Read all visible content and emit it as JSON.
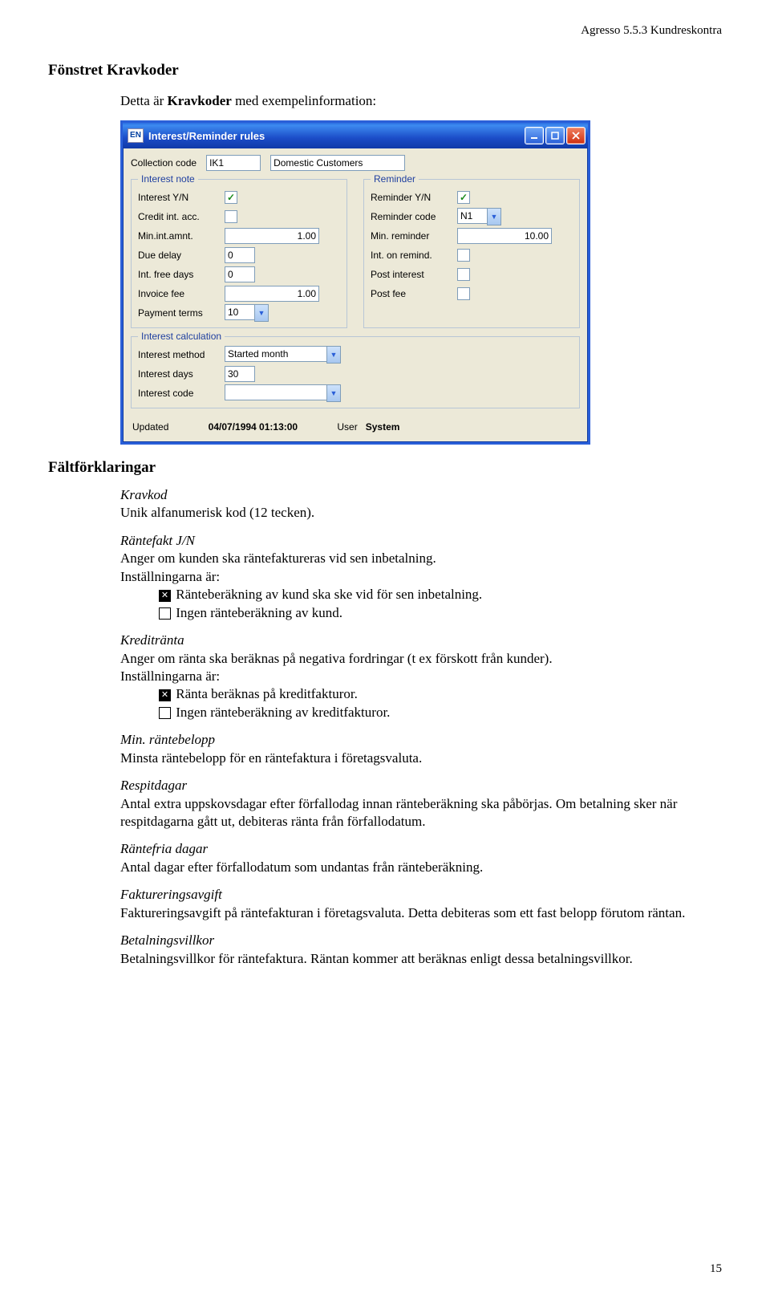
{
  "header": {
    "running": "Agresso 5.5.3 Kundreskontra"
  },
  "section_title": "Fönstret Kravkoder",
  "intro_prefix": "Detta är ",
  "intro_bold": "Kravkoder",
  "intro_suffix": " med exempelinformation:",
  "dialog": {
    "badge": "EN",
    "title": "Interest/Reminder rules",
    "collection_code_label": "Collection code",
    "collection_code": "IK1",
    "collection_name": "Domestic Customers",
    "group_interest": "Interest note",
    "group_reminder": "Reminder",
    "interest_yn_label": "Interest Y/N",
    "credit_int_acc_label": "Credit int. acc.",
    "min_int_amnt_label": "Min.int.amnt.",
    "min_int_amnt": "1.00",
    "due_delay_label": "Due delay",
    "due_delay": "0",
    "int_free_days_label": "Int. free days",
    "int_free_days": "0",
    "invoice_fee_label": "Invoice fee",
    "invoice_fee": "1.00",
    "payment_terms_label": "Payment terms",
    "payment_terms": "10",
    "reminder_yn_label": "Reminder Y/N",
    "reminder_code_label": "Reminder code",
    "reminder_code": "N1",
    "min_reminder_label": "Min. reminder",
    "min_reminder": "10.00",
    "int_on_remind_label": "Int. on remind.",
    "post_interest_label": "Post interest",
    "post_fee_label": "Post fee",
    "group_calc": "Interest calculation",
    "interest_method_label": "Interest method",
    "interest_method": "Started month",
    "interest_days_label": "Interest days",
    "interest_days": "30",
    "interest_code_label": "Interest code",
    "updated_label": "Updated",
    "updated": "04/07/1994 01:13:00",
    "user_label": "User",
    "user": "System"
  },
  "explain_title": "Fältförklaringar",
  "e": {
    "kravkod_t": "Kravkod",
    "kravkod_d": "Unik alfanumerisk kod (12 tecken).",
    "rantjn_t": "Räntefakt J/N",
    "rantjn_d": "Anger om kunden ska räntefaktureras vid sen inbetalning.",
    "inst": "Inställningarna är:",
    "rantjn_opt1": "Ränteberäkning av kund ska ske vid för sen inbetalning.",
    "rantjn_opt2": "Ingen ränteberäkning av kund.",
    "kredit_t": "Kreditränta",
    "kredit_d": "Anger om ränta ska beräknas på negativa fordringar (t ex förskott från kunder).",
    "kredit_opt1": "Ränta beräknas på kreditfakturor.",
    "kredit_opt2": "Ingen ränteberäkning av kreditfakturor.",
    "minr_t": "Min. räntebelopp",
    "minr_d": "Minsta räntebelopp för en räntefaktura i företagsvaluta.",
    "respit_t": "Respitdagar",
    "respit_d": "Antal extra uppskovsdagar efter förfallodag innan ränteberäkning ska påbörjas. Om betalning sker när respitdagarna gått ut, debiteras ränta från förfallodatum.",
    "rfri_t": "Räntefria dagar",
    "rfri_d": "Antal dagar efter förfallodatum som undantas från ränteberäkning.",
    "favg_t": "Faktureringsavgift",
    "favg_d": "Faktureringsavgift på räntefakturan i företagsvaluta. Detta debiteras som ett fast belopp förutom räntan.",
    "bvill_t": "Betalningsvillkor",
    "bvill_d": "Betalningsvillkor för räntefaktura. Räntan kommer att beräknas enligt dessa betalningsvillkor."
  },
  "pagenum": "15"
}
